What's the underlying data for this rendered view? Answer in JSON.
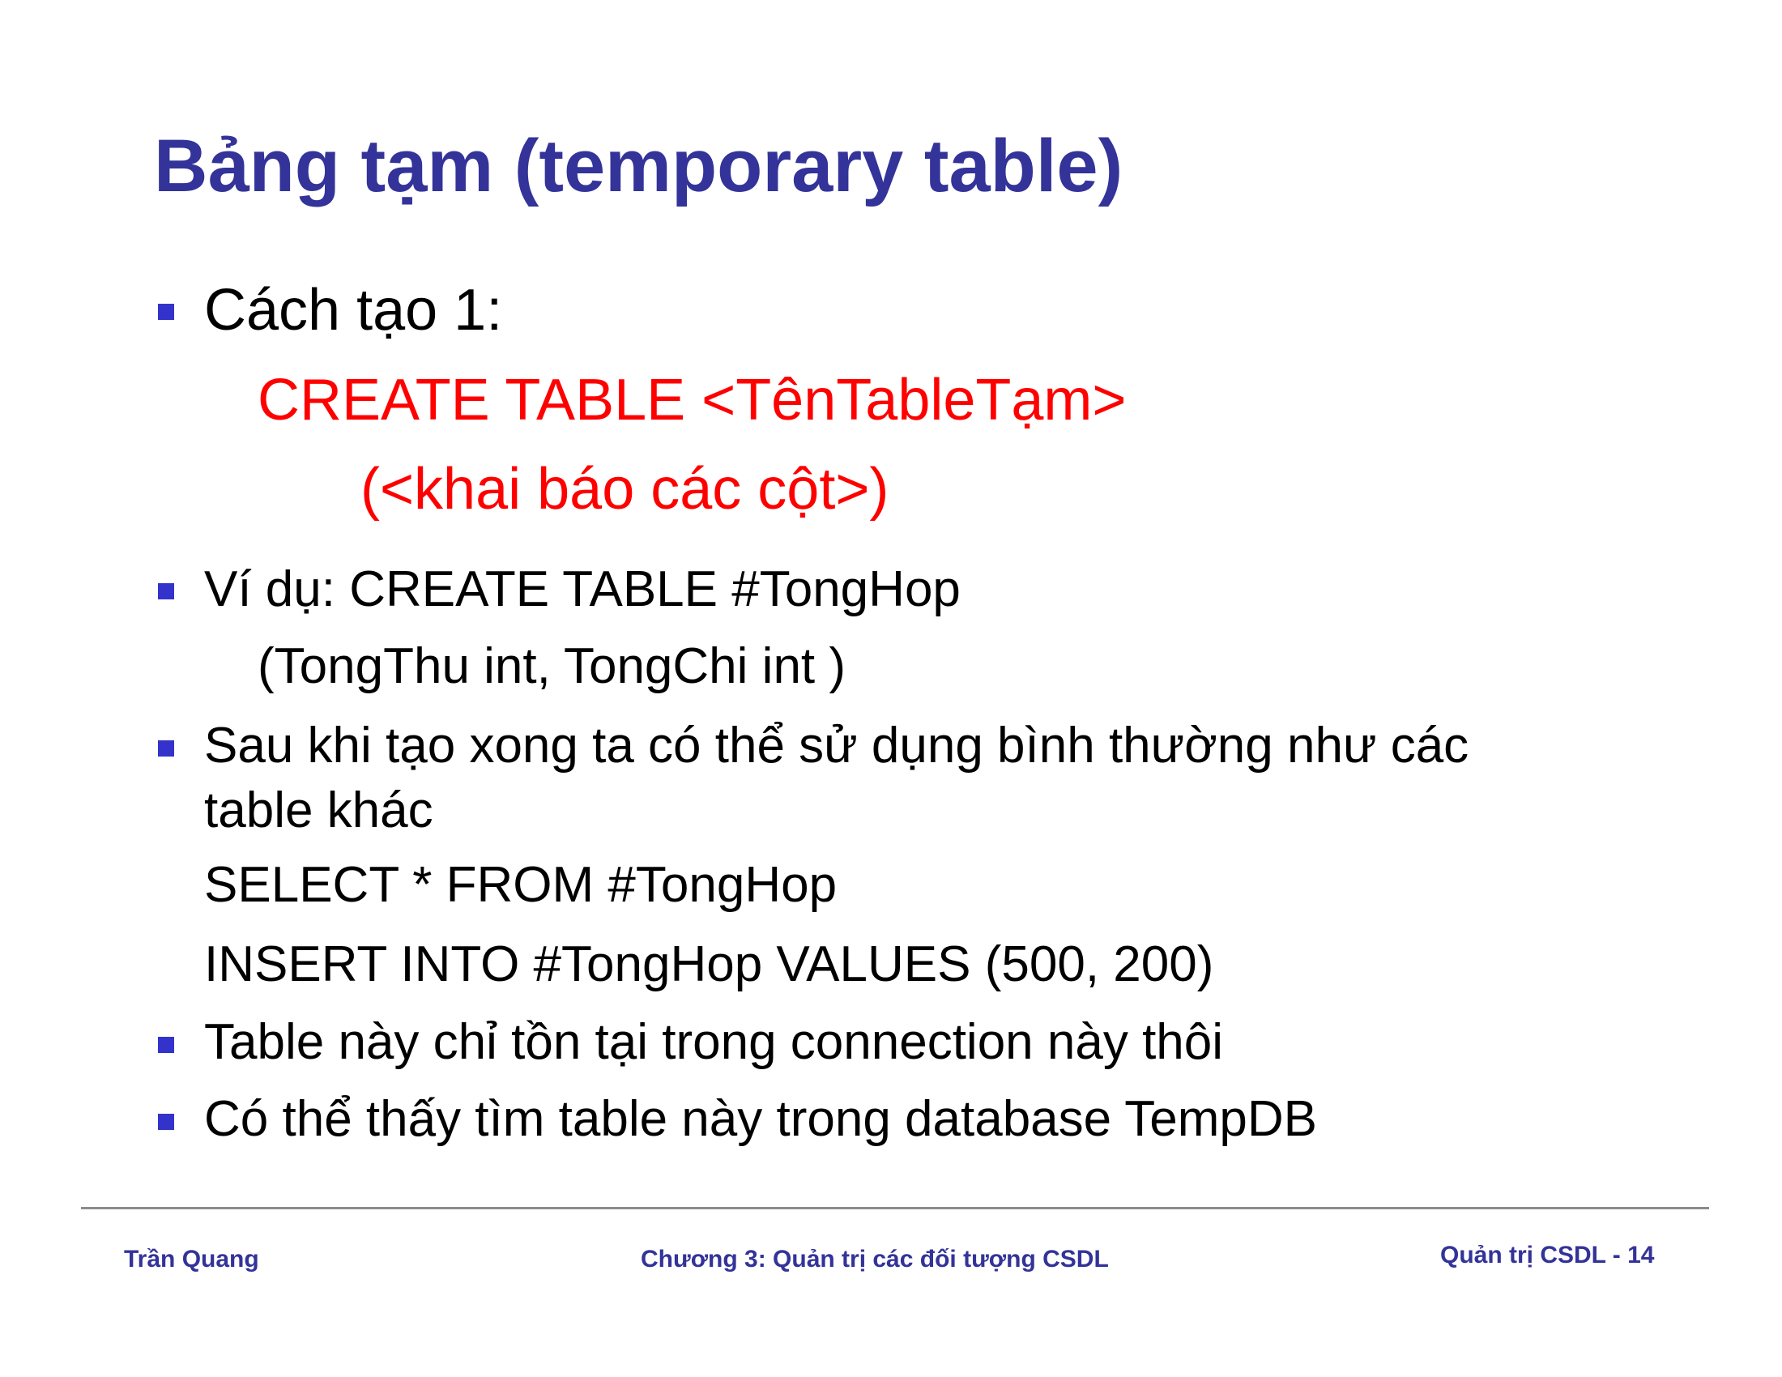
{
  "slide": {
    "title": "Bảng tạm (temporary table)",
    "bullets": [
      {
        "lines": [
          "Cách tạo 1:"
        ],
        "code_lines": [
          "CREATE TABLE  <TênTableTạm>",
          "(<khai báo các cột>)"
        ]
      },
      {
        "lines": [
          "Ví dụ: CREATE TABLE  #TongHop",
          "(TongThu int,  TongChi int )"
        ]
      },
      {
        "lines": [
          "Sau khi tạo xong ta có thể sử dụng bình thường như các",
          "table khác",
          "SELECT * FROM #TongHop",
          "INSERT INTO #TongHop VALUES (500, 200)"
        ]
      },
      {
        "lines": [
          "Table này chỉ tồn tại trong connection này thôi"
        ]
      },
      {
        "lines": [
          "Có thể thấy tìm table này trong database TempDB"
        ]
      }
    ]
  },
  "footer": {
    "author": "Trần Quang",
    "chapter": "Chương 3: Quản trị các đối tượng CSDL",
    "page": "Quản trị CSDL - 14"
  },
  "colors": {
    "title": "#333399",
    "bullet": "#3333cc",
    "code": "#ff0000",
    "footer": "#333399",
    "rule": "#8c8c8c"
  }
}
